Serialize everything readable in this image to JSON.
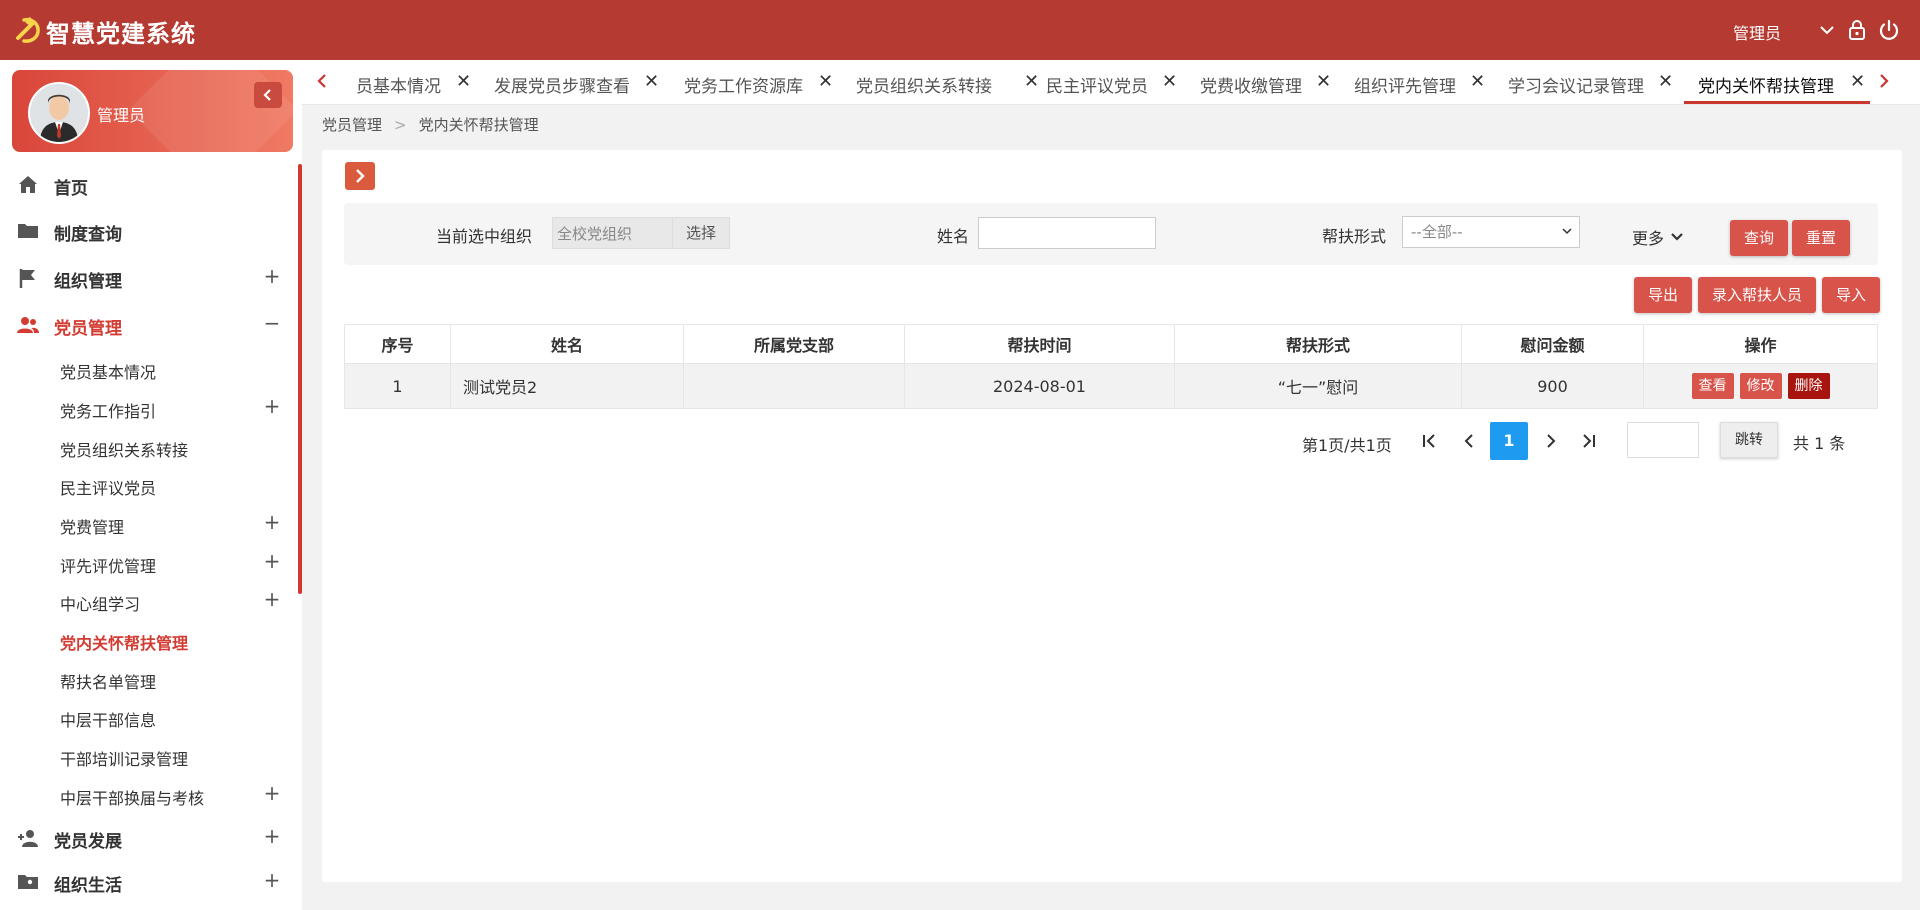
{
  "app": {
    "title": "智慧党建系统",
    "user": "管理员"
  },
  "colors": {
    "brand": "#b53a32",
    "accent": "#d23c33",
    "pager_active": "#1e9bf0"
  },
  "sidebar": {
    "card_name": "管理员",
    "items": [
      {
        "label": "首页",
        "icon": "home-icon"
      },
      {
        "label": "制度查询",
        "icon": "folder-icon"
      },
      {
        "label": "组织管理",
        "icon": "flag-icon",
        "expand": "+"
      },
      {
        "label": "党员管理",
        "icon": "users-icon",
        "expand": "−"
      }
    ],
    "sub_items": [
      {
        "label": "党员基本情况",
        "expand": ""
      },
      {
        "label": "党务工作指引",
        "expand": "+"
      },
      {
        "label": "党员组织关系转接",
        "expand": ""
      },
      {
        "label": "民主评议党员",
        "expand": ""
      },
      {
        "label": "党费管理",
        "expand": "+"
      },
      {
        "label": "评先评优管理",
        "expand": "+"
      },
      {
        "label": "中心组学习",
        "expand": "+"
      },
      {
        "label": "党内关怀帮扶管理",
        "expand": ""
      },
      {
        "label": "帮扶名单管理",
        "expand": ""
      },
      {
        "label": "中层干部信息",
        "expand": ""
      },
      {
        "label": "干部培训记录管理",
        "expand": ""
      },
      {
        "label": "中层干部换届与考核",
        "expand": "+"
      }
    ],
    "bottom_items": [
      {
        "label": "党员发展",
        "icon": "user-add-icon",
        "expand": "+"
      },
      {
        "label": "组织生活",
        "icon": "folder-user-icon",
        "expand": "+"
      }
    ]
  },
  "tabs": [
    "员基本情况",
    "发展党员步骤查看",
    "党务工作资源库",
    "党员组织关系转接",
    "民主评议党员",
    "党费收缴管理",
    "组织评先管理",
    "学习会议记录管理",
    "党内关怀帮扶管理"
  ],
  "breadcrumb": {
    "parent": "党员管理",
    "sep": ">",
    "current": "党内关怀帮扶管理"
  },
  "filter": {
    "org_label": "当前选中组织",
    "org_value": "全校党组织",
    "org_select": "选择",
    "name_label": "姓名",
    "help_label": "帮扶形式",
    "help_value": "--全部--",
    "more": "更多",
    "query": "查询",
    "reset": "重置"
  },
  "actions": {
    "export": "导出",
    "add": "录入帮扶人员",
    "import": "导入"
  },
  "table": {
    "headers": [
      "序号",
      "姓名",
      "所属党支部",
      "帮扶时间",
      "帮扶形式",
      "慰问金额",
      "操作"
    ],
    "rows": [
      {
        "no": "1",
        "name": "测试党员2",
        "branch": "",
        "date": "2024-08-01",
        "form": "“七一”慰问",
        "amount": "900"
      }
    ],
    "ops": {
      "view": "查看",
      "edit": "修改",
      "delete": "删除"
    }
  },
  "pager": {
    "info": "第1页/共1页",
    "current": "1",
    "jump": "跳转",
    "total": "共 1 条"
  }
}
